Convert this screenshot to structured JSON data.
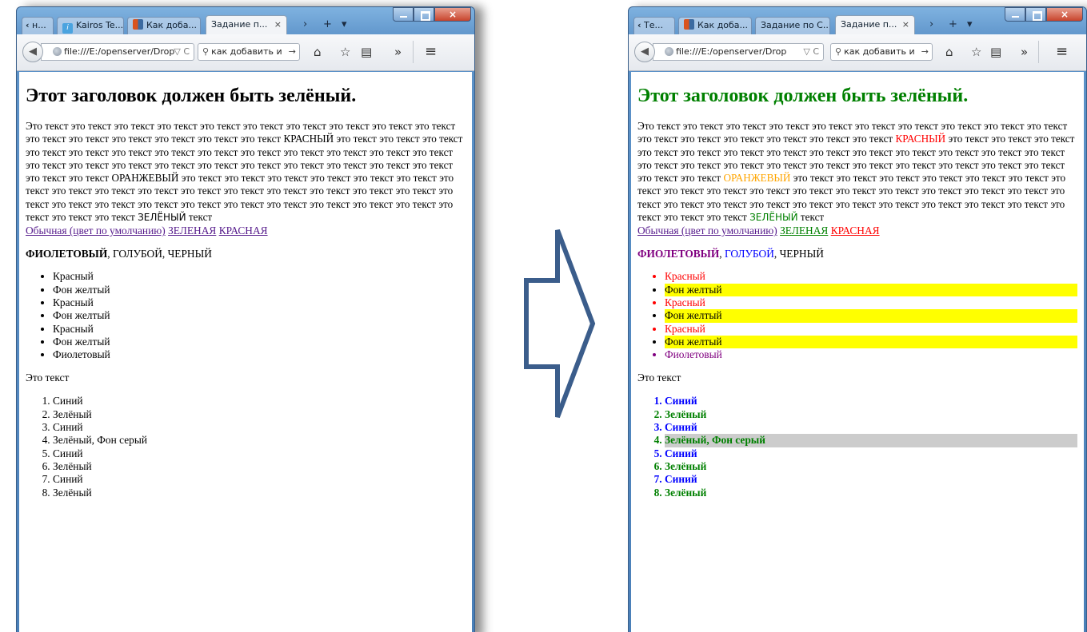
{
  "left": {
    "tabs": [
      {
        "label": "н...",
        "icon": "nav-back-arrow"
      },
      {
        "label": "Kairos Te...",
        "icon": "info-favicon"
      },
      {
        "label": "Как доба...",
        "icon": "stackoverflow-favicon"
      },
      {
        "label": "Задание п...",
        "active": true
      }
    ],
    "url": "file:///E:/openserver/Drop",
    "search": "как добавить и",
    "title": "Этот заголовок должен быть зелёный.",
    "para": {
      "l1": "Это текст это текст это текст это текст это текст это текст это текст это текст это текст это текст это текст это текст это текст это текст это текст это текст",
      "red": "КРАСНЫЙ",
      "l2": " это текст это текст это текст это текст это текст это текст это текст это текст это текст это текст это текст это текст это текст это текст это текст это текст это текст это текст это текст это текст это текст это текст это текст это текст это текст ",
      "orange": "ОРАНЖЕВЫЙ",
      "l3": " это текст это текст это текст это текст это текст это текст это текст это текст это текст это текст это текст это текст это текст это текст это текст это текст это текст это текст это текст это текст это текст это текст это текст это текст это текст это текст это текст это текст это текст ",
      "green": "ЗЕЛЁНЫЙ",
      "l4": " текст"
    },
    "links": {
      "default": "Обычная (цвет по умолчанию)",
      "green": "ЗЕЛЕНАЯ",
      "red": "КРАСНАЯ"
    },
    "colors": {
      "purple": "ФИОЛЕТОВЫЙ",
      "blue": "ГОЛУБОЙ",
      "black": "ЧЕРНЫЙ"
    },
    "ul": [
      "Красный",
      "Фон желтый",
      "Красный",
      "Фон желтый",
      "Красный",
      "Фон желтый",
      "Фиолетовый"
    ],
    "ptext": "Это текст",
    "ol": [
      "Синий",
      "Зелёный",
      "Синий",
      "Зелёный, Фон серый",
      "Синий",
      "Зелёный",
      "Синий",
      "Зелёный"
    ]
  },
  "right": {
    "tabs": [
      {
        "label": "Те...",
        "icon": "nav-back-arrow"
      },
      {
        "label": "Как доба...",
        "icon": "stackoverflow-favicon"
      },
      {
        "label": "Задание по С..."
      },
      {
        "label": "Задание п...",
        "active": true
      }
    ],
    "url": "file:///E:/openserver/Drop",
    "search": "как добавить и",
    "title": "Этот заголовок должен быть зелёный.",
    "para": {
      "l1": "Это текст это текст это текст это текст это текст это текст это текст это текст это текст это текст это текст это текст это текст это текст это текст это текст",
      "red": "КРАСНЫЙ",
      "l2": " это текст это текст это текст это текст это текст это текст это текст это текст это текст это текст это текст это текст это текст это текст это текст это текст это текст это текст это текст это текст это текст это текст это текст это текст это текст ",
      "orange": "ОРАНЖЕВЫЙ",
      "l3": " это текст это текст это текст это текст это текст это текст это текст это текст это текст это текст это текст это текст это текст это текст это текст это текст это текст это текст это текст это текст это текст это текст это текст это текст это текст это текст это текст это текст это текст ",
      "green": "ЗЕЛЁНЫЙ",
      "l4": " текст"
    },
    "links": {
      "default": "Обычная (цвет по умолчанию)",
      "green": "ЗЕЛЕНАЯ",
      "red": "КРАСНАЯ"
    },
    "colors": {
      "purple": "ФИОЛЕТОВЫЙ",
      "blue": "ГОЛУБОЙ",
      "black": "ЧЕРНЫЙ"
    },
    "ul": [
      "Красный",
      "Фон желтый",
      "Красный",
      "Фон желтый",
      "Красный",
      "Фон желтый",
      "Фиолетовый"
    ],
    "ptext": "Это текст",
    "ol": [
      "Синий",
      "Зелёный",
      "Синий",
      "Зелёный, Фон серый",
      "Синий",
      "Зелёный",
      "Синий",
      "Зелёный"
    ]
  },
  "palette": {
    "green": "#008000",
    "red": "#ff0000",
    "orange": "#ffa500",
    "purple": "#800080",
    "blue": "#0000ff",
    "yellow_bg": "#ffff00",
    "gray_bg": "#cccccc",
    "link_visited": "#551a8b",
    "arrow_stroke": "#3b5d8b"
  },
  "glyphs": {
    "close": "×",
    "new_tab": "+",
    "tab_list": "▾",
    "scroll_right": "›",
    "back": "◀",
    "reload": "C",
    "dropdown": "▽",
    "search": "🔍",
    "go": "→",
    "home": "⌂",
    "bookmark": "☆",
    "reader": "▤",
    "overflow": "»",
    "menu": "≡"
  }
}
